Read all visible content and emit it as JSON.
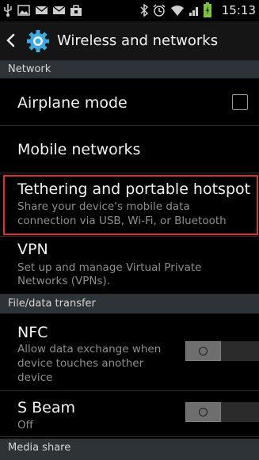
{
  "status_bar": {
    "time": "15:13",
    "icons": [
      "usb-icon",
      "image-icon",
      "message-icon",
      "message-icon",
      "bag-icon",
      "bluetooth-icon",
      "alarm-icon",
      "wifi-icon",
      "signal-icon",
      "battery-icon"
    ]
  },
  "action_bar": {
    "title": "Wireless and networks"
  },
  "sections": {
    "network": "Network",
    "file_transfer": "File/data transfer",
    "media_share": "Media share"
  },
  "items": {
    "airplane": {
      "title": "Airplane mode",
      "checked": false
    },
    "mobile": {
      "title": "Mobile networks"
    },
    "tethering": {
      "title": "Tethering and portable hotspot",
      "sub1": "Share your device's mobile data",
      "sub2": "connection via USB, Wi-Fi, or Bluetooth"
    },
    "vpn": {
      "title": "VPN",
      "sub1": "Set up and manage Virtual Private",
      "sub2": "Networks (VPNs)."
    },
    "nfc": {
      "title": "NFC",
      "sub1": "Allow data exchange when",
      "sub2": "device touches another",
      "sub3": "device",
      "enabled": false
    },
    "sbeam": {
      "title": "S Beam",
      "sub1": "Off",
      "enabled": false
    }
  },
  "colors": {
    "section_bg": "#2e3338",
    "highlight": "#d9342b",
    "gear": "#3fa9e0"
  }
}
